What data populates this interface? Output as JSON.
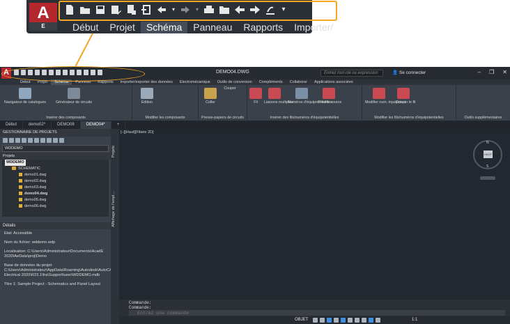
{
  "zoom": {
    "logo_letter": "A",
    "logo_sub": "E",
    "qat_icons": [
      "new-file-icon",
      "open-folder-icon",
      "save-icon",
      "save-as-icon",
      "plot-icon",
      "export-icon",
      "undo-icon",
      "undo-dropdown-icon",
      "redo-icon",
      "redo-dropdown-icon",
      "print-icon",
      "project-folder-icon",
      "back-icon",
      "forward-icon",
      "sweep-icon",
      "customize-dropdown-icon"
    ],
    "tabs": [
      "Début",
      "Projet",
      "Schéma",
      "Panneau",
      "Rapports",
      "Importer/"
    ],
    "active_tab": "Schéma"
  },
  "window": {
    "doc_title": "DEMO04.DWG",
    "search_placeholder": "Entrez mot-clé ou expression",
    "signin": "Se connecter"
  },
  "menutabs": [
    "Début",
    "Projet",
    "Schéma",
    "Panneau",
    "Rapports",
    "Importer/exporter des données",
    "Electromécanique",
    "Outils de conversion",
    "Compléments",
    "Collaborer",
    "Applications associées"
  ],
  "menutabs_active": "Schéma",
  "ribbon": {
    "groups": [
      {
        "label": "Insérer des composants",
        "buttons": [
          "Navigateur de catalogues",
          "Générateur de circuits"
        ]
      },
      {
        "label": "Modifier les composants",
        "buttons": [
          "Edition"
        ]
      },
      {
        "label": "Presse-papiers de circuits",
        "buttons": [
          "Coller",
          "Couper"
        ]
      },
      {
        "label": "Insérer des fils/numéros d'équipotentielles",
        "buttons": [
          "Fil",
          "Liaisons multiples",
          "Numéros d'équipotentielles",
          "Flèche source"
        ]
      },
      {
        "label": "Modifier les fils/numéros d'équipotentielles",
        "buttons": [
          "Modifier num. équipotent.",
          "Couper le fil"
        ]
      },
      {
        "label": "Outils supplémentaires",
        "buttons": []
      }
    ]
  },
  "doctabs": [
    "Début",
    "demo02*",
    "DEMO08",
    "DEMO04*",
    "+"
  ],
  "doctabs_active": "DEMO04*",
  "project_manager": {
    "title": "GESTIONNAIRE DE PROJETS",
    "current_project": "WDDEMO",
    "projects_label": "Projets",
    "tree": [
      {
        "kind": "project",
        "label": "WDDEMO"
      },
      {
        "kind": "folder",
        "label": "SCHEMATIC"
      },
      {
        "kind": "dwg",
        "label": "demo01.dwg"
      },
      {
        "kind": "dwg",
        "label": "demo02.dwg"
      },
      {
        "kind": "dwg",
        "label": "demo03.dwg"
      },
      {
        "kind": "dwg",
        "label": "demo04.dwg"
      },
      {
        "kind": "dwg",
        "label": "demo05.dwg"
      },
      {
        "kind": "dwg",
        "label": "demo06.dwg"
      }
    ],
    "side_tabs": [
      "Projets",
      "Affichage de l'empl..."
    ],
    "details_title": "Détails",
    "details": [
      "Etat: Accessible",
      "Nom du fichier: wddemo.wdp",
      "Localisation: C:\\Users\\Administrateur\\Documents\\AcadE 2020\\AeData\\proj\\Demo",
      "Base de données du projet: C:\\Users\\Administrateur\\AppData\\Roaming\\Autodesk\\AutoCAD Electrical 2020\\R23.1\\fra\\Support\\user\\WDDEMO.mdb",
      "Titre 1: Sample Project - Schematics and Panel Layout"
    ]
  },
  "canvas": {
    "view_label": "[−][Haut][Filaire 2D]",
    "compass": {
      "n": "N",
      "s": "S",
      "cube": "HAUT"
    }
  },
  "command": {
    "history": [
      "Commande:",
      "Commande:"
    ],
    "placeholder": "Entrez une commande"
  },
  "status": {
    "model": "OBJET",
    "scale": "1:1"
  },
  "colors": {
    "accent": "#f5a623",
    "logo": "#b4282d",
    "bg_dark": "#2a2e35",
    "ribbon": "#3b414a",
    "canvas": "#212830"
  }
}
